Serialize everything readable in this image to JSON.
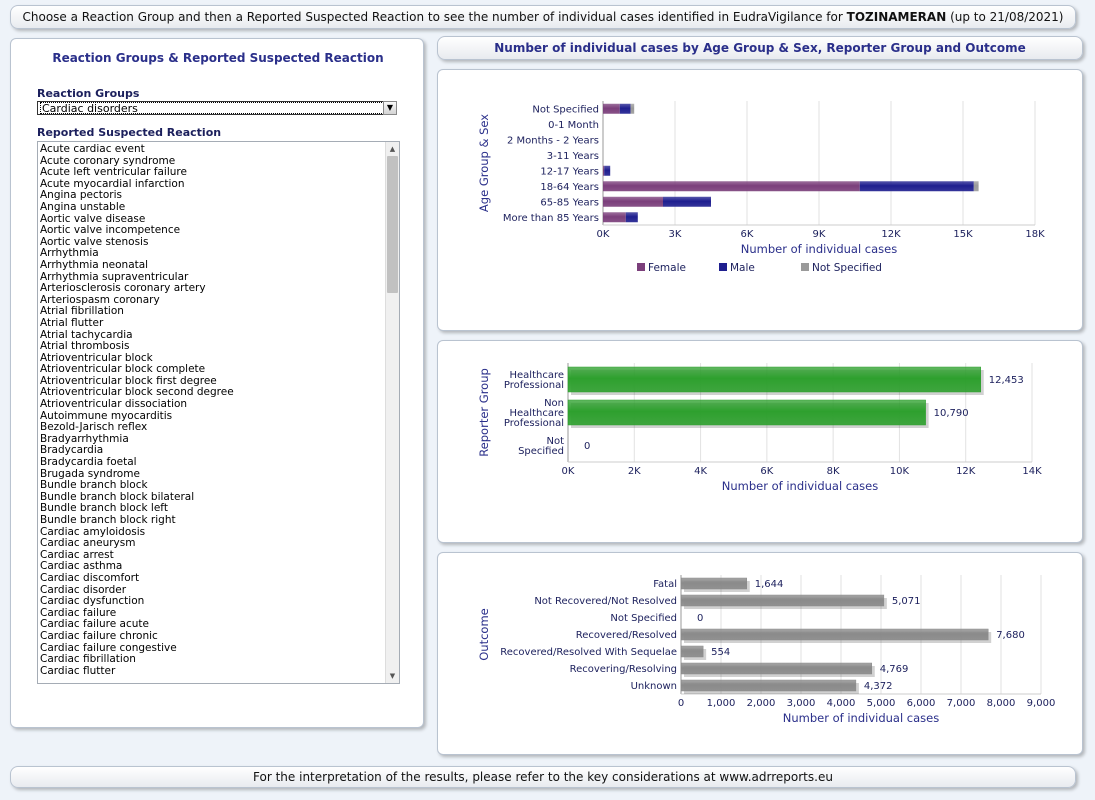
{
  "banner": {
    "prefix": "Choose a Reaction Group and then a Reported Suspected Reaction to see the number of individual cases identified in EudraVigilance for",
    "product": "TOZINAMERAN",
    "suffix": "(up to 21/08/2021)"
  },
  "footer": {
    "text": "For the interpretation of the results, please refer to the key considerations at www.adrreports.eu"
  },
  "left_panel": {
    "title": "Reaction Groups & Reported Suspected Reaction",
    "reaction_groups_label": "Reaction Groups",
    "reaction_groups_selected": "Cardiac disorders",
    "reported_reaction_label": "Reported Suspected Reaction",
    "reactions": [
      "Acute cardiac event",
      "Acute coronary syndrome",
      "Acute left ventricular failure",
      "Acute myocardial infarction",
      "Angina pectoris",
      "Angina unstable",
      "Aortic valve disease",
      "Aortic valve incompetence",
      "Aortic valve stenosis",
      "Arrhythmia",
      "Arrhythmia neonatal",
      "Arrhythmia supraventricular",
      "Arteriosclerosis coronary artery",
      "Arteriospasm coronary",
      "Atrial fibrillation",
      "Atrial flutter",
      "Atrial tachycardia",
      "Atrial thrombosis",
      "Atrioventricular block",
      "Atrioventricular block complete",
      "Atrioventricular block first degree",
      "Atrioventricular block second degree",
      "Atrioventricular dissociation",
      "Autoimmune myocarditis",
      "Bezold-Jarisch reflex",
      "Bradyarrhythmia",
      "Bradycardia",
      "Bradycardia foetal",
      "Brugada syndrome",
      "Bundle branch block",
      "Bundle branch block bilateral",
      "Bundle branch block left",
      "Bundle branch block right",
      "Cardiac amyloidosis",
      "Cardiac aneurysm",
      "Cardiac arrest",
      "Cardiac asthma",
      "Cardiac discomfort",
      "Cardiac disorder",
      "Cardiac dysfunction",
      "Cardiac failure",
      "Cardiac failure acute",
      "Cardiac failure chronic",
      "Cardiac failure congestive",
      "Cardiac fibrillation",
      "Cardiac flutter"
    ]
  },
  "right_header": {
    "title": "Number of individual cases by Age Group & Sex, Reporter Group and Outcome"
  },
  "chart_data": [
    {
      "type": "bar",
      "stacked": true,
      "orientation": "horizontal",
      "categories": [
        "Not Specified",
        "0-1 Month",
        "2 Months - 2 Years",
        "3-11 Years",
        "12-17 Years",
        "18-64 Years",
        "65-85 Years",
        "More than 85 Years"
      ],
      "series": [
        {
          "name": "Female",
          "values": [
            700,
            0,
            0,
            0,
            50,
            10700,
            2500,
            950
          ]
        },
        {
          "name": "Male",
          "values": [
            450,
            0,
            0,
            0,
            250,
            4750,
            2000,
            500
          ]
        },
        {
          "name": "Not Specified",
          "values": [
            150,
            0,
            0,
            0,
            0,
            200,
            0,
            0
          ]
        }
      ],
      "colors": [
        "#7b3f7b",
        "#1f1f8f",
        "#9a9a9a"
      ],
      "xlabel": "Number of individual cases",
      "ylabel": "Age Group & Sex",
      "xlim": [
        0,
        18000
      ],
      "ticks": [
        "0K",
        "3K",
        "6K",
        "9K",
        "12K",
        "15K",
        "18K"
      ],
      "grid": true,
      "legend": "bottom"
    },
    {
      "type": "bar",
      "orientation": "horizontal",
      "categories": [
        "Healthcare Professional",
        "Non Healthcare Professional",
        "Not Specified"
      ],
      "values": [
        12453,
        10790,
        0
      ],
      "data_labels": [
        "12,453",
        "10,790",
        "0"
      ],
      "colors": [
        "#2ea02e"
      ],
      "xlabel": "Number of individual cases",
      "ylabel": "Reporter Group",
      "xlim": [
        0,
        14000
      ],
      "ticks": [
        "0K",
        "2K",
        "4K",
        "6K",
        "8K",
        "10K",
        "12K",
        "14K"
      ],
      "grid": true
    },
    {
      "type": "bar",
      "orientation": "horizontal",
      "categories": [
        "Fatal",
        "Not Recovered/Not Resolved",
        "Not Specified",
        "Recovered/Resolved",
        "Recovered/Resolved With Sequelae",
        "Recovering/Resolving",
        "Unknown"
      ],
      "values": [
        1644,
        5071,
        0,
        7680,
        554,
        4769,
        4372
      ],
      "data_labels": [
        "1,644",
        "5,071",
        "0",
        "7,680",
        "554",
        "4,769",
        "4,372"
      ],
      "colors": [
        "#8a8a8a"
      ],
      "xlabel": "Number of individual cases",
      "ylabel": "Outcome",
      "xlim": [
        0,
        9000
      ],
      "ticks": [
        "0",
        "1,000",
        "2,000",
        "3,000",
        "4,000",
        "5,000",
        "6,000",
        "7,000",
        "8,000",
        "9,000"
      ],
      "grid": true
    }
  ]
}
